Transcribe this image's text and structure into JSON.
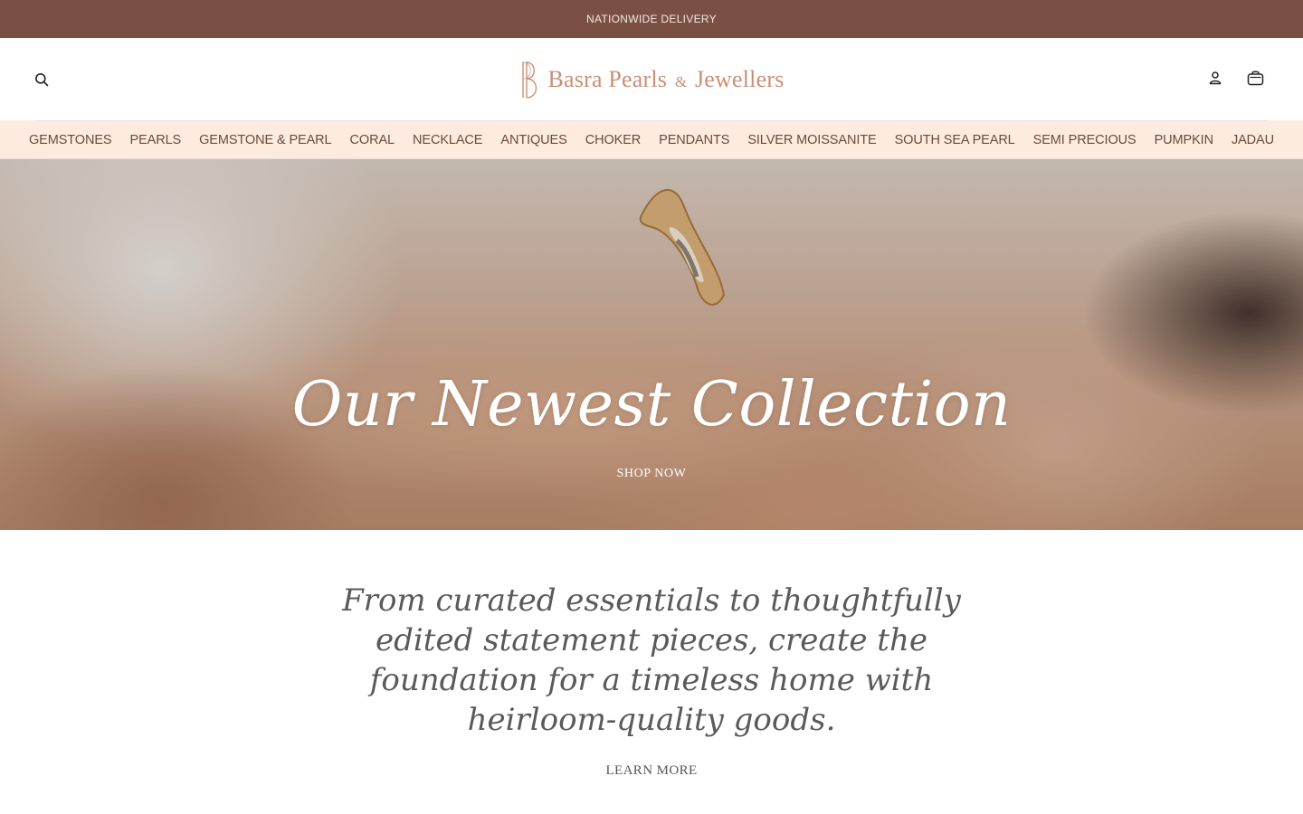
{
  "announcement": {
    "text": "NATIONWIDE DELIVERY"
  },
  "header": {
    "brand_main": "Basra Pearls",
    "brand_amp": "&",
    "brand_tail": "Jewellers",
    "icons": {
      "search": "search-icon",
      "account": "user-icon",
      "cart": "bag-icon"
    }
  },
  "nav": {
    "items": [
      {
        "label": "GEMSTONES"
      },
      {
        "label": "PEARLS"
      },
      {
        "label": "GEMSTONE & PEARL"
      },
      {
        "label": "CORAL"
      },
      {
        "label": "NECKLACE"
      },
      {
        "label": "ANTIQUES"
      },
      {
        "label": "CHOKER"
      },
      {
        "label": "PENDANTS"
      },
      {
        "label": "SILVER MOISSANITE"
      },
      {
        "label": "SOUTH SEA PEARL"
      },
      {
        "label": "SEMI PRECIOUS"
      },
      {
        "label": "PUMPKIN"
      },
      {
        "label": "JADAU"
      }
    ]
  },
  "hero": {
    "title": "Our Newest Collection",
    "cta": "SHOP NOW"
  },
  "intro": {
    "tagline": "From curated essentials to thoughtfully edited statement pieces, create the foundation for a timeless home with heirloom-quality goods.",
    "cta": "LEARN MORE"
  },
  "colors": {
    "announcement_bg": "#7a5045",
    "nav_bg": "#fdebe0",
    "brand": "#c98f76",
    "nav_text": "#6b4a3c"
  }
}
